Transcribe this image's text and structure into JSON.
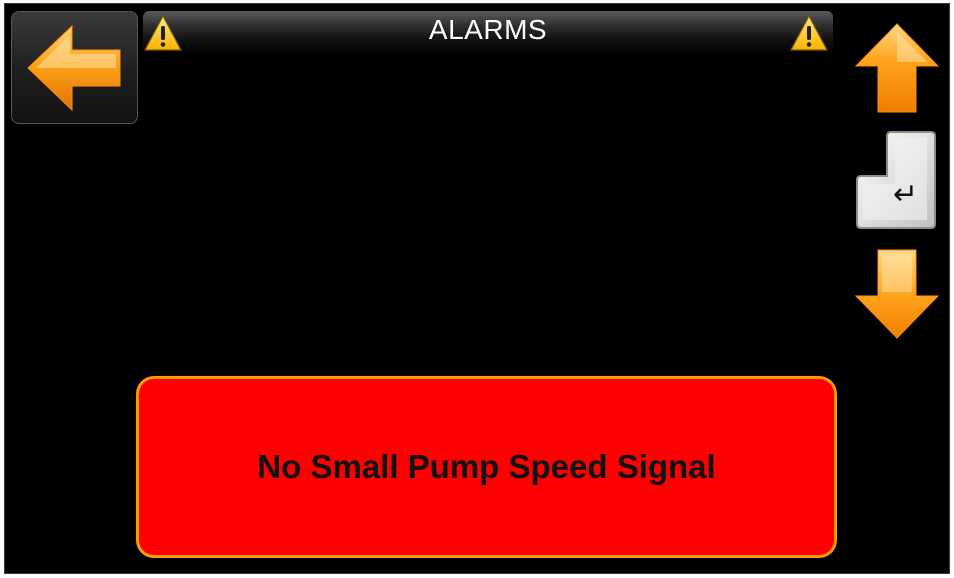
{
  "header": {
    "title": "ALARMS"
  },
  "alarm": {
    "message": "No Small Pump Speed Signal"
  },
  "navigation": {
    "back_icon": "arrow-left-icon",
    "up_icon": "arrow-up-icon",
    "enter_icon": "enter-key-icon",
    "down_icon": "arrow-down-icon"
  },
  "colors": {
    "background": "#000000",
    "alarm_fill": "#ff0000",
    "alarm_border": "#ff9a00",
    "arrow_orange": "#ff9900",
    "warning_yellow": "#ffcc00"
  }
}
